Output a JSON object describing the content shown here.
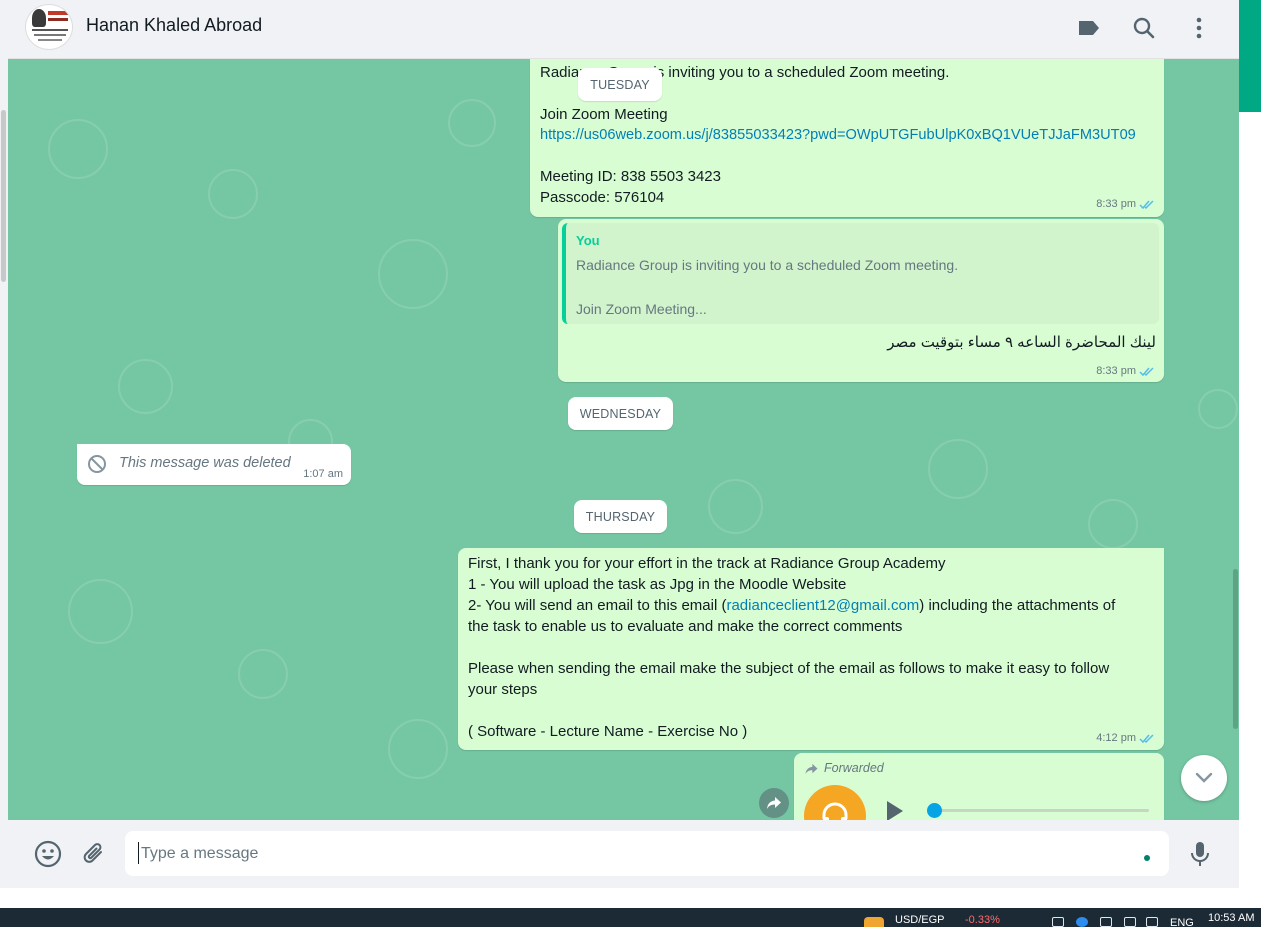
{
  "header": {
    "chat_title": "Hanan Khaled Abroad",
    "icons": [
      "label-icon",
      "search-icon",
      "menu-icon"
    ]
  },
  "colors": {
    "chat_background": "#75c7a3",
    "outgoing_bubble": "#d9fdd3",
    "incoming_bubble": "#ffffff",
    "link": "#027eb5",
    "read_ticks": "#53bdeb",
    "quote_author": "#06cf9c",
    "accent": "#00a884"
  },
  "day_pills": {
    "tuesday": "TUESDAY",
    "wednesday": "WEDNESDAY",
    "thursday": "THURSDAY"
  },
  "messages": {
    "zoom": {
      "text_line1": "Radiance Group is inviting you to a scheduled Zoom meeting.",
      "text_line2": "Join Zoom Meeting",
      "link": "https://us06web.zoom.us/j/83855033423?pwd=OWpUTGFubUlpK0xBQ1VUeTJJaFM3UT09",
      "meeting_id": "Meeting ID: 838 5503 3423",
      "passcode": "Passcode: 576104",
      "time": "8:33 pm"
    },
    "reply": {
      "quote_author": "You",
      "quote_line1": "Radiance Group is inviting you to a scheduled Zoom meeting.",
      "quote_line2": "Join Zoom Meeting...",
      "text": "لينك المحاضرة الساعه ٩ مساء بتوقيت مصر",
      "time": "8:33 pm"
    },
    "deleted": {
      "text": "This message was deleted",
      "time": "1:07 am"
    },
    "instructions": {
      "line1": "First, I thank you for your effort in the track at Radiance Group Academy",
      "line2": "1 - You will upload the task as Jpg in the Moodle Website",
      "line3_before": "2- You will send an email to this email (",
      "line3_email": "radianceclient12@gmail.com",
      "line3_after": ") including the attachments of",
      "line4": "the task to enable us to evaluate and make the correct comments",
      "line5": "Please when sending the email make the subject of the email as follows to make it easy to follow",
      "line6": "your steps",
      "line7": "( Software - Lecture Name - Exercise No )",
      "time": "4:12 pm"
    },
    "forwarded": {
      "label": "Forwarded",
      "progress": 0
    }
  },
  "composer": {
    "placeholder": "Type a message",
    "icons": [
      "emoji-icon",
      "attach-icon",
      "mic-icon"
    ]
  },
  "taskbar": {
    "currency": "USD/EGP",
    "change": "-0.33%",
    "lang": "ENG",
    "clock": "10:53 AM"
  }
}
